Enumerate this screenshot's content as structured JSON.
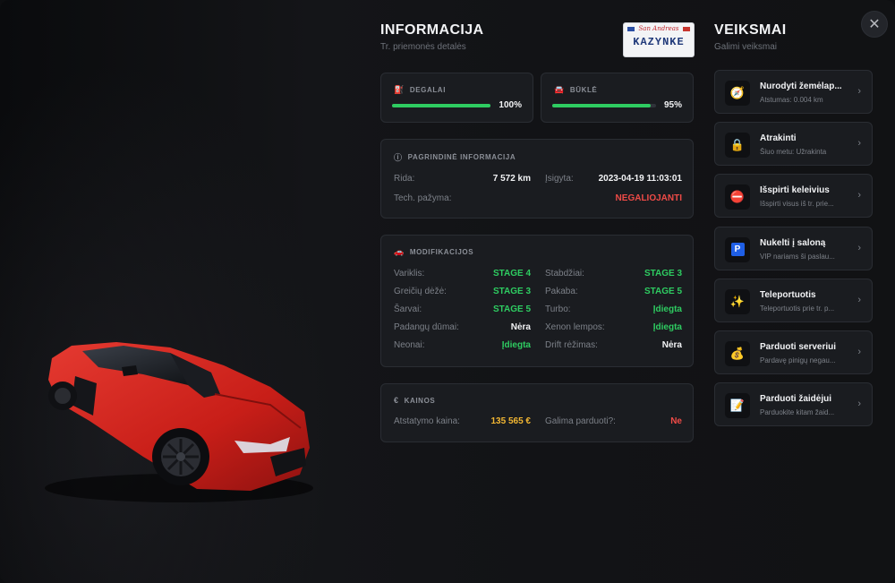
{
  "info": {
    "title": "INFORMACIJA",
    "subtitle": "Tr. priemonės detalės",
    "plate": {
      "state": "San Andreas",
      "number": "KAZYNKE"
    }
  },
  "fuel": {
    "label": "DEGALAI",
    "value": "100%",
    "level": 100
  },
  "condition": {
    "label": "BŪKLĖ",
    "value": "95%",
    "level": 95
  },
  "basic": {
    "title": "PAGRINDINĖ INFORMACIJA",
    "mileage_label": "Rida:",
    "mileage_value": "7 572 km",
    "acquired_label": "Įsigyta:",
    "acquired_value": "2023-04-19 11:03:01",
    "inspection_label": "Tech. pažyma:",
    "inspection_value": "NEGALIOJANTI"
  },
  "mods": {
    "title": "MODIFIKACIJOS",
    "left": [
      {
        "label": "Variklis:",
        "value": "STAGE 4"
      },
      {
        "label": "Greičių dėžė:",
        "value": "STAGE 3"
      },
      {
        "label": "Šarvai:",
        "value": "STAGE 5"
      },
      {
        "label": "Padangų dūmai:",
        "value": "Nėra"
      },
      {
        "label": "Neonai:",
        "value": "Įdiegta"
      }
    ],
    "right": [
      {
        "label": "Stabdžiai:",
        "value": "STAGE 3"
      },
      {
        "label": "Pakaba:",
        "value": "STAGE 5"
      },
      {
        "label": "Turbo:",
        "value": "Įdiegta"
      },
      {
        "label": "Xenon lempos:",
        "value": "Įdiegta"
      },
      {
        "label": "Drift rėžimas:",
        "value": "Nėra"
      }
    ]
  },
  "prices": {
    "title": "KAINOS",
    "restore_label": "Atstatymo kaina:",
    "restore_value": "135 565 €",
    "sellable_label": "Galima parduoti?:",
    "sellable_value": "Ne"
  },
  "actions": {
    "title": "VEIKSMAI",
    "subtitle": "Galimi veiksmai",
    "items": [
      {
        "title": "Nurodyti žemėlap...",
        "sub": "Atstumas: 0.004 km",
        "icon": "compass-icon"
      },
      {
        "title": "Atrakinti",
        "sub": "Šiuo metu: Užrakinta",
        "icon": "lock-icon"
      },
      {
        "title": "Išspirti keleivius",
        "sub": "Išspirti visus iš tr. prie...",
        "icon": "stop-icon"
      },
      {
        "title": "Nukelti į saloną",
        "sub": "VIP nariams ši paslau...",
        "icon": "parking-icon"
      },
      {
        "title": "Teleportuotis",
        "sub": "Teleportuotis prie tr. p...",
        "icon": "sparkles-icon"
      },
      {
        "title": "Parduoti serveriui",
        "sub": "Pardavę pinigų negau...",
        "icon": "money-bag-icon"
      },
      {
        "title": "Parduoti žaidėjui",
        "sub": "Parduokite kitam žaid...",
        "icon": "document-icon"
      }
    ]
  },
  "colors": {
    "green": "#2ecc61",
    "red": "#ef4b47",
    "gold": "#f2b632",
    "car": "#d8241f"
  }
}
